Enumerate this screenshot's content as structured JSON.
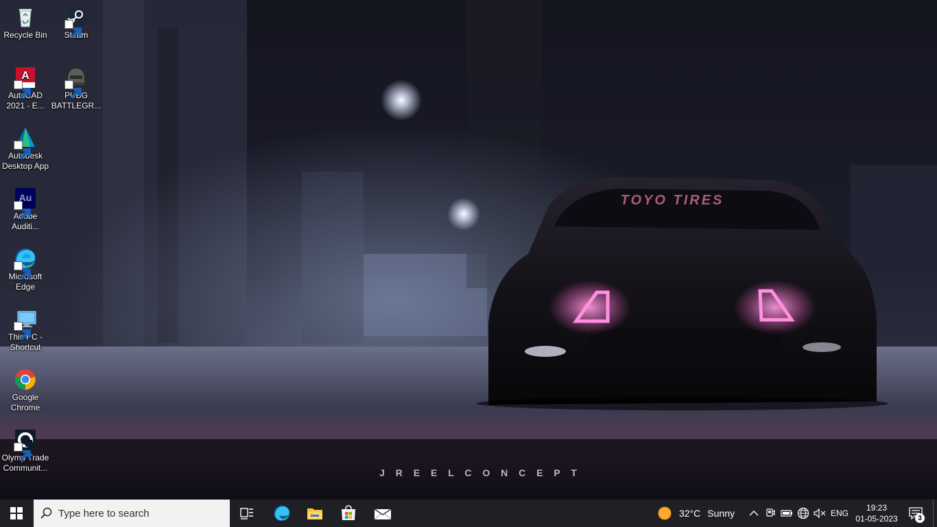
{
  "wallpaper": {
    "windshield_text": "TOYO TIRES",
    "watermark_text": "J R E E L   C O N C E P T"
  },
  "desktop_icons": [
    {
      "label": "Recycle Bin",
      "icon": "recycle-bin-icon"
    },
    {
      "label": "Steam",
      "icon": "steam-icon"
    },
    {
      "label": "AutoCAD\n2021 - E...",
      "icon": "autocad-icon"
    },
    {
      "label": "PUBG\nBATTLEGR...",
      "icon": "pubg-icon"
    },
    {
      "label": "Autodesk\nDesktop App",
      "icon": "autodesk-icon"
    },
    {
      "label": "Adobe\nAuditi...",
      "icon": "adobe-audition-icon",
      "glyph": "Au"
    },
    {
      "label": "Microsoft\nEdge",
      "icon": "edge-icon"
    },
    {
      "label": "This PC -\nShortcut",
      "icon": "this-pc-icon"
    },
    {
      "label": "Google\nChrome",
      "icon": "chrome-icon"
    },
    {
      "label": "Olymp Trade\nCommunit...",
      "icon": "olymp-trade-icon"
    }
  ],
  "taskbar": {
    "search_placeholder": "Type here to search",
    "pinned": [
      "task-view-icon",
      "edge-icon",
      "file-explorer-icon",
      "microsoft-store-icon",
      "mail-icon"
    ],
    "weather": {
      "temperature": "32°C",
      "condition": "Sunny"
    },
    "language": "ENG",
    "time": "19:23",
    "date": "01-05-2023",
    "notification_count": "3"
  },
  "colors": {
    "taskbar_bg": "#1f2023",
    "search_bg": "#f2f2f2",
    "tail_light": "#ff5fc8",
    "accent_blue": "#0078d7"
  }
}
